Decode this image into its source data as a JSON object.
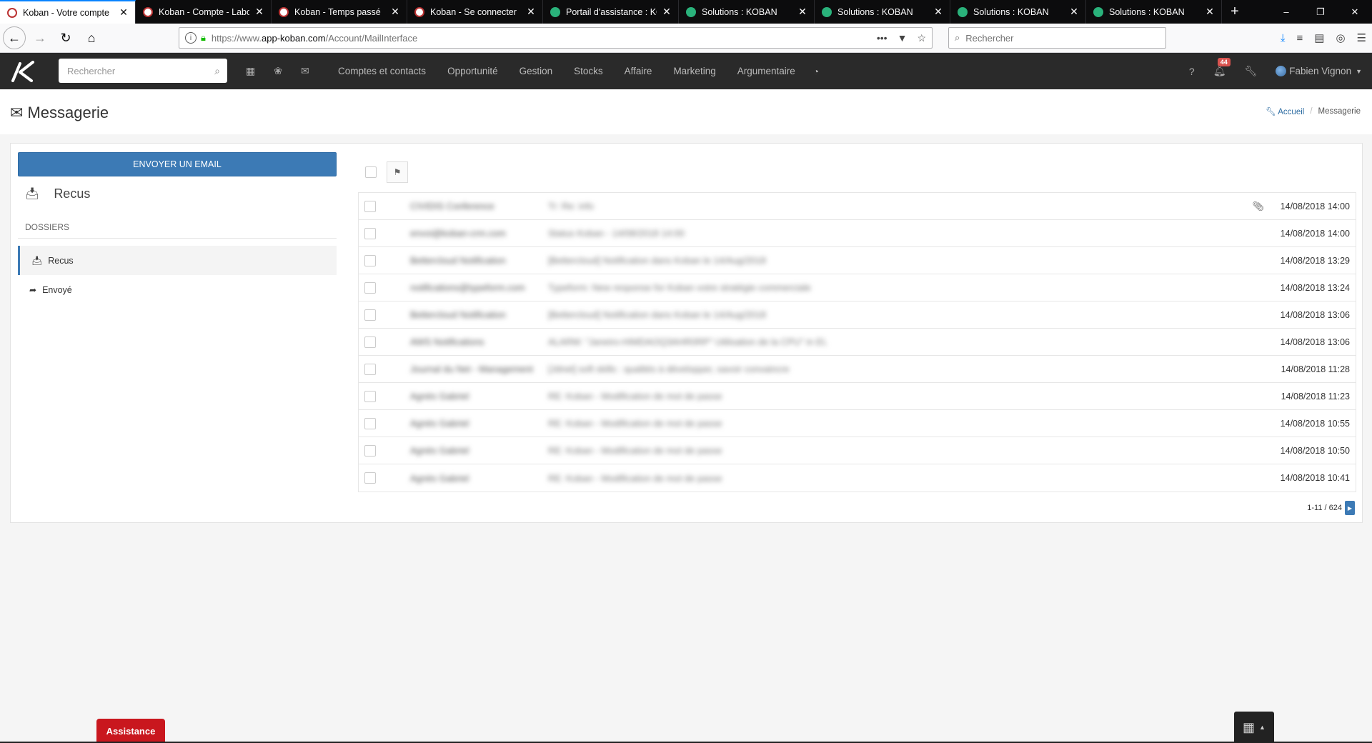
{
  "browser": {
    "tabs": [
      {
        "title": "Koban - Votre compte",
        "icon": "koban",
        "active": true
      },
      {
        "title": "Koban - Compte - Labor",
        "icon": "koban",
        "active": false
      },
      {
        "title": "Koban - Temps passé",
        "icon": "koban",
        "active": false
      },
      {
        "title": "Koban - Se connecter",
        "icon": "koban",
        "active": false
      },
      {
        "title": "Portail d'assistance : KOI",
        "icon": "support",
        "active": false
      },
      {
        "title": "Solutions : KOBAN",
        "icon": "support",
        "active": false
      },
      {
        "title": "Solutions : KOBAN",
        "icon": "support",
        "active": false
      },
      {
        "title": "Solutions : KOBAN",
        "icon": "support",
        "active": false
      },
      {
        "title": "Solutions : KOBAN",
        "icon": "support",
        "active": false
      }
    ],
    "url_prefix": "https://www.",
    "url_host": "app-koban.com",
    "url_path": "/Account/MailInterface",
    "search_placeholder": "Rechercher"
  },
  "app": {
    "search_placeholder": "Rechercher",
    "menu": [
      "Comptes et contacts",
      "Opportunité",
      "Gestion",
      "Stocks",
      "Affaire",
      "Marketing",
      "Argumentaire"
    ],
    "notification_count": "44",
    "user_name": "Fabien Vignon",
    "accent_color": "#3c7ab5"
  },
  "page": {
    "title": "Messagerie",
    "breadcrumb_home": "Accueil",
    "breadcrumb_current": "Messagerie"
  },
  "sidebar": {
    "send_label": "ENVOYER UN EMAIL",
    "box_title": "Recus",
    "folders_label": "DOSSIERS",
    "folders": [
      "Recus",
      "Envoyé"
    ]
  },
  "mails": [
    {
      "from": "CIVIDIS Conference",
      "subject": "Tr: Re: info",
      "date": "14/08/2018 14:00",
      "attachment": true
    },
    {
      "from": "envoi@koban-crm.com",
      "subject": "Status Koban - 14/08/2018 14:00",
      "date": "14/08/2018 14:00",
      "attachment": false
    },
    {
      "from": "Bettercloud Notification",
      "subject": "[Bettercloud] Notification dans Koban le 14/Aug/2018",
      "date": "14/08/2018 13:29",
      "attachment": false
    },
    {
      "from": "notifications@typeform.com",
      "subject": "Typeform: New response for Koban votre stratégie commerciale",
      "date": "14/08/2018 13:24",
      "attachment": false
    },
    {
      "from": "Bettercloud Notification",
      "subject": "[Bettercloud] Notification dans Koban le 14/Aug/2018",
      "date": "14/08/2018 13:06",
      "attachment": false
    },
    {
      "from": "AWS Notifications",
      "subject": "ALARM: \"Janeiro-HIMDAOQ3AHR0RP\" Utilisation de la CPU\" in EU",
      "date": "14/08/2018 13:06",
      "attachment": false
    },
    {
      "from": "Journal du Net - Management",
      "subject": "[Jdnet] soft skills : qualités à développer, savoir convaincre",
      "date": "14/08/2018 11:28",
      "attachment": false
    },
    {
      "from": "Agnès Gabriel",
      "subject": "RE: Koban - Modification de mot de passe",
      "date": "14/08/2018 11:23",
      "attachment": false
    },
    {
      "from": "Agnès Gabriel",
      "subject": "RE: Koban - Modification de mot de passe",
      "date": "14/08/2018 10:55",
      "attachment": false
    },
    {
      "from": "Agnès Gabriel",
      "subject": "RE: Koban - Modification de mot de passe",
      "date": "14/08/2018 10:50",
      "attachment": false
    },
    {
      "from": "Agnès Gabriel",
      "subject": "RE: Koban - Modification de mot de passe",
      "date": "14/08/2018 10:41",
      "attachment": false
    }
  ],
  "pager": {
    "label": "1-11 / 624"
  },
  "widgets": {
    "assistance_label": "Assistance"
  }
}
